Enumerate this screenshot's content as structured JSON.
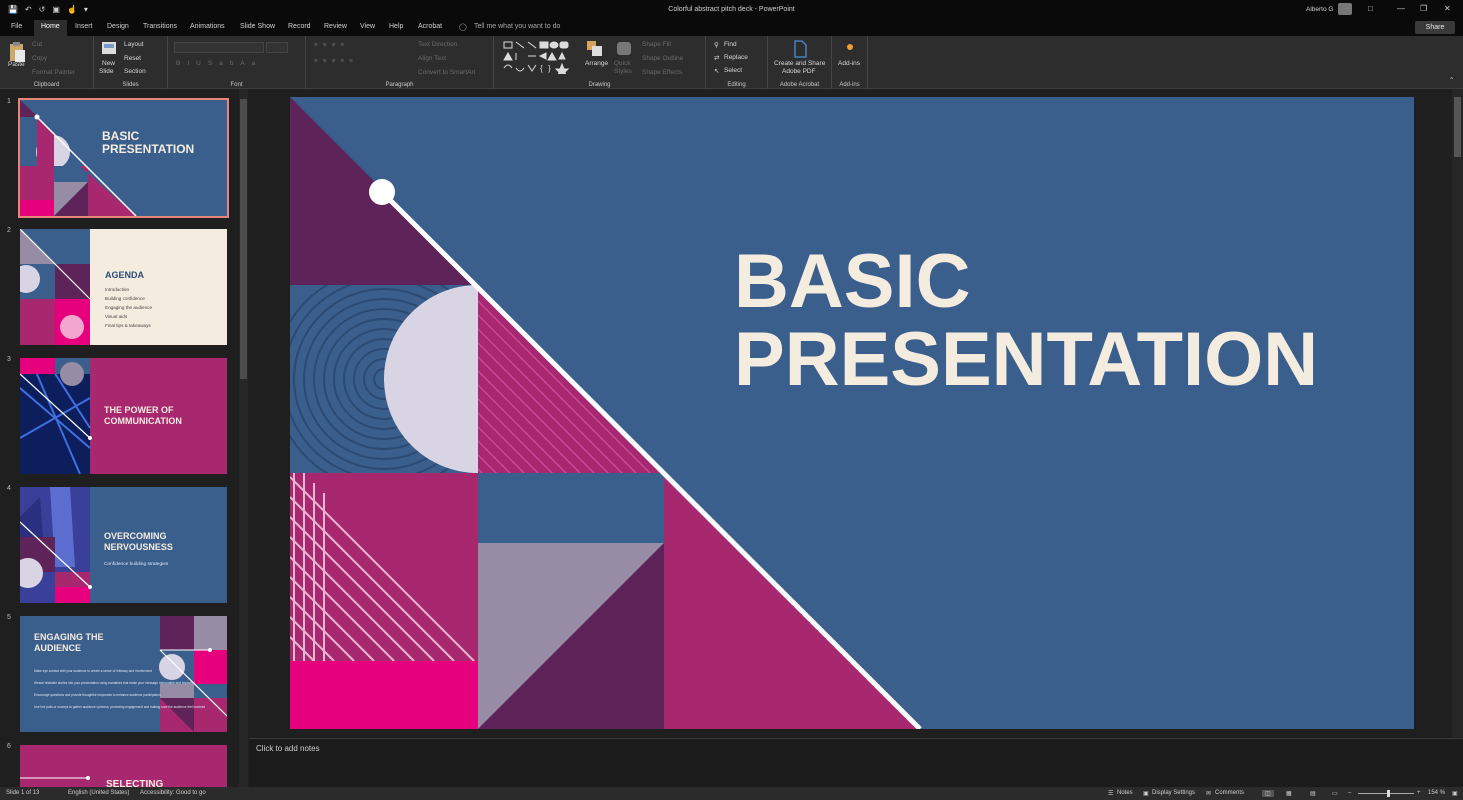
{
  "window": {
    "title": "Colorful abstract pitch deck  -  PowerPoint",
    "user": "Alberto G"
  },
  "tabs": [
    "File",
    "Home",
    "Insert",
    "Design",
    "Transitions",
    "Animations",
    "Slide Show",
    "Record",
    "Review",
    "View",
    "Help",
    "Acrobat"
  ],
  "tell_me": "Tell me what you want to do",
  "share_label": "Share",
  "ribbon": {
    "clipboard": {
      "paste": "Paste",
      "cut": "Cut",
      "copy": "Copy",
      "format_painter": "Format Painter",
      "label": "Clipboard"
    },
    "slides": {
      "new_slide": "New",
      "new_slide2": "Slide",
      "layout": "Layout",
      "reset": "Reset",
      "section": "Section",
      "label": "Slides"
    },
    "font": {
      "label": "Font"
    },
    "paragraph": {
      "text_direction": "Text Direction",
      "align_text": "Align Text",
      "convert_smartart": "Convert to SmartArt",
      "label": "Paragraph"
    },
    "drawing": {
      "arrange": "Arrange",
      "quick_styles": "Quick",
      "quick_styles2": "Styles",
      "shape_fill": "Shape Fill",
      "shape_outline": "Shape Outline",
      "shape_effects": "Shape Effects",
      "label": "Drawing"
    },
    "editing": {
      "find": "Find",
      "replace": "Replace",
      "select": "Select",
      "label": "Editing"
    },
    "acrobat": {
      "create1": "Create and Share",
      "create2": "Adobe PDF",
      "label": "Adobe Acrobat"
    },
    "addins": {
      "addins": "Add-ins",
      "label": "Add-ins"
    }
  },
  "thumbnails": [
    {
      "num": "1",
      "title1": "BASIC",
      "title2": "PRESENTATION"
    },
    {
      "num": "2",
      "title": "AGENDA",
      "items": [
        "Introduction",
        "Building confidence",
        "Engaging the audience",
        "Visual aids",
        "Final tips & takeaways"
      ]
    },
    {
      "num": "3",
      "title1": "THE POWER OF",
      "title2": "COMMUNICATION"
    },
    {
      "num": "4",
      "title1": "OVERCOMING",
      "title2": "NERVOUSNESS",
      "sub": "Confidence building strategies"
    },
    {
      "num": "5",
      "title1": "ENGAGING THE",
      "title2": "AUDIENCE",
      "body": [
        "Make eye contact with your audience to create a sense of intimacy and involvement",
        "Weave relatable stories into your presentation using narratives that make your message memorable and impactful",
        "Encourage questions and provide thoughtful responses to enhance audience participation",
        "Use live polls or surveys to gather audience opinions, promoting engagement and making sure the audience feel involved"
      ]
    },
    {
      "num": "6",
      "title1": "SELECTING"
    }
  ],
  "slide": {
    "title1": "BASIC",
    "title2": "PRESENTATION"
  },
  "notes_placeholder": "Click to add notes",
  "status": {
    "slide": "Slide 1 of 13",
    "language": "English (United States)",
    "accessibility": "Accessibility: Good to go",
    "notes": "Notes",
    "display": "Display Settings",
    "comments": "Comments",
    "zoom": "154 %"
  },
  "colors": {
    "blue": "#3a5f8c",
    "magenta": "#a8286f",
    "plum": "#5e2358",
    "pink": "#e6007e",
    "cream": "#f5ece0",
    "lavender": "#968ca6"
  }
}
